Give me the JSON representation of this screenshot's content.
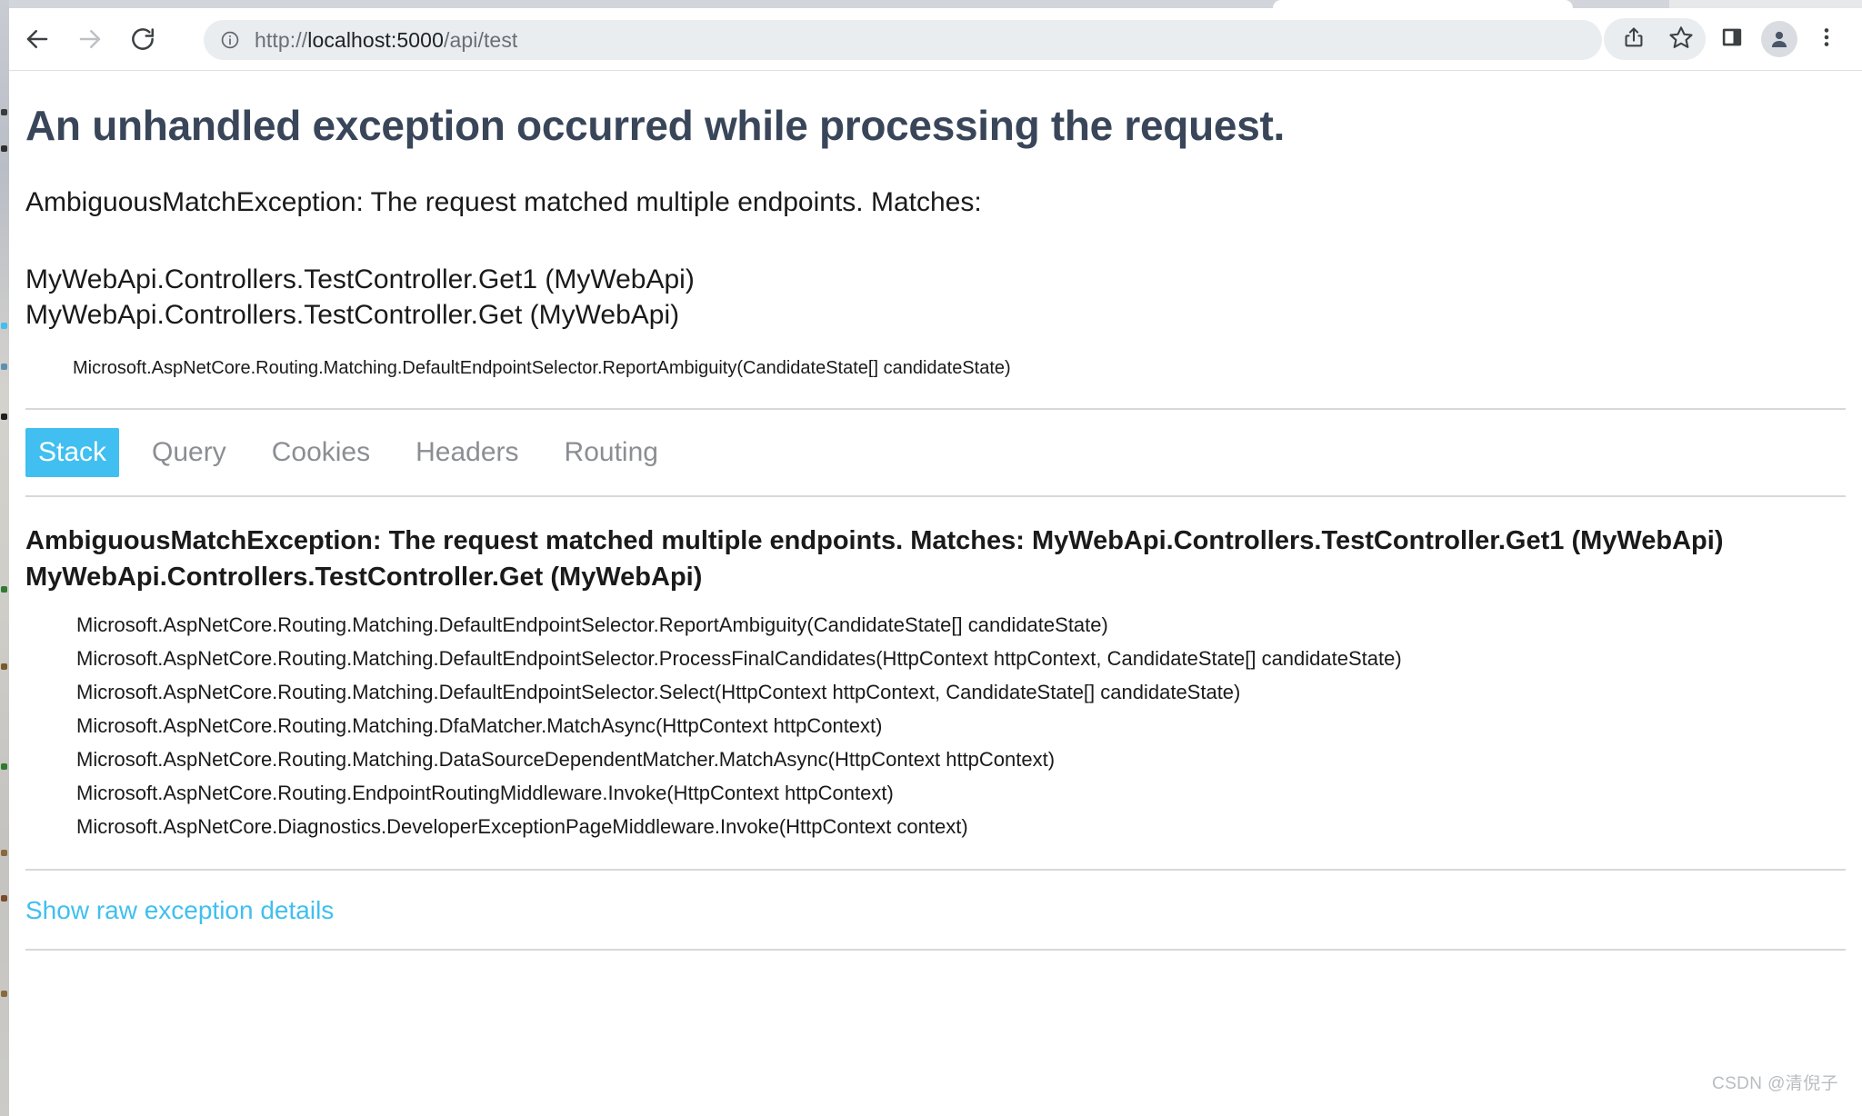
{
  "browser": {
    "back_icon": "back-arrow-icon",
    "forward_icon": "forward-arrow-icon",
    "reload_icon": "reload-icon",
    "info_icon": "site-info-icon",
    "url_scheme": "http://",
    "url_host": "localhost:5000",
    "url_path": "/api/test",
    "url_full": "http://localhost:5000/api/test",
    "share_icon": "share-icon",
    "bookmark_icon": "star-icon",
    "side_panel_icon": "side-panel-icon",
    "profile_icon": "profile-avatar-icon",
    "menu_icon": "three-dot-menu-icon"
  },
  "error_page": {
    "title": "An unhandled exception occurred while processing the request.",
    "message": "AmbiguousMatchException: The request matched multiple endpoints. Matches:",
    "matches": [
      "MyWebApi.Controllers.TestController.Get1 (MyWebApi)",
      "MyWebApi.Controllers.TestController.Get (MyWebApi)"
    ],
    "top_frame": "Microsoft.AspNetCore.Routing.Matching.DefaultEndpointSelector.ReportAmbiguity(CandidateState[] candidateState)",
    "tabs": [
      {
        "label": "Stack",
        "active": true
      },
      {
        "label": "Query",
        "active": false
      },
      {
        "label": "Cookies",
        "active": false
      },
      {
        "label": "Headers",
        "active": false
      },
      {
        "label": "Routing",
        "active": false
      }
    ],
    "stack_heading": "AmbiguousMatchException: The request matched multiple endpoints. Matches: MyWebApi.Controllers.TestController.Get1 (MyWebApi) MyWebApi.Controllers.TestController.Get (MyWebApi)",
    "stack_frames": [
      "Microsoft.AspNetCore.Routing.Matching.DefaultEndpointSelector.ReportAmbiguity(CandidateState[] candidateState)",
      "Microsoft.AspNetCore.Routing.Matching.DefaultEndpointSelector.ProcessFinalCandidates(HttpContext httpContext, CandidateState[] candidateState)",
      "Microsoft.AspNetCore.Routing.Matching.DefaultEndpointSelector.Select(HttpContext httpContext, CandidateState[] candidateState)",
      "Microsoft.AspNetCore.Routing.Matching.DfaMatcher.MatchAsync(HttpContext httpContext)",
      "Microsoft.AspNetCore.Routing.Matching.DataSourceDependentMatcher.MatchAsync(HttpContext httpContext)",
      "Microsoft.AspNetCore.Routing.EndpointRoutingMiddleware.Invoke(HttpContext httpContext)",
      "Microsoft.AspNetCore.Diagnostics.DeveloperExceptionPageMiddleware.Invoke(HttpContext context)"
    ],
    "raw_details_link": "Show raw exception details"
  },
  "watermark": "CSDN @清倪子",
  "colors": {
    "accent_blue": "#40bff0",
    "title_slate": "#39465a",
    "tab_inactive": "#8b8e93",
    "divider": "#d7d8da"
  }
}
